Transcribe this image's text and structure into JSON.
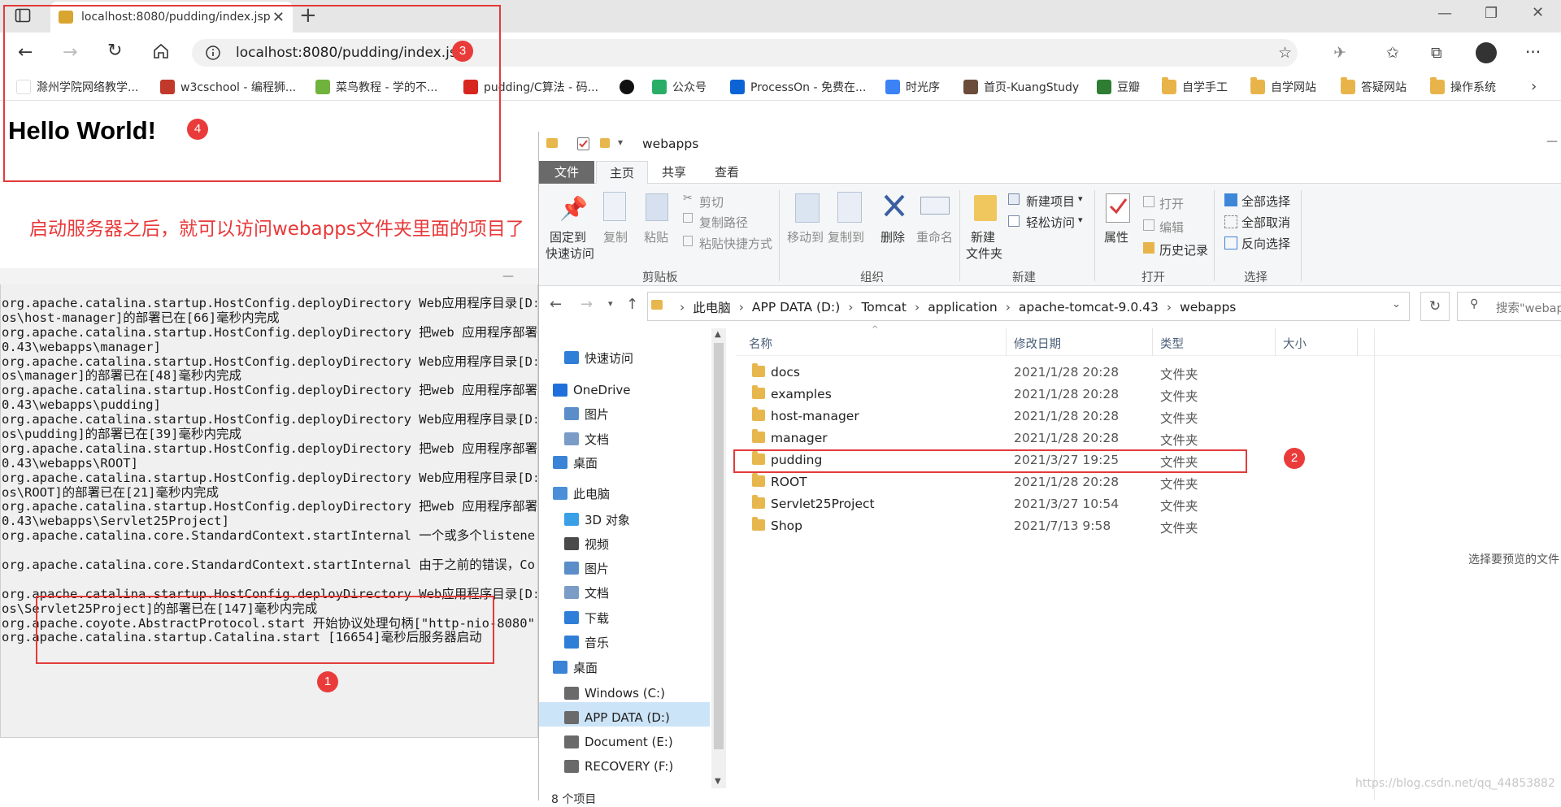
{
  "browser": {
    "tab_title": "localhost:8080/pudding/index.jsp",
    "url": "localhost:8080/pudding/index.jsp",
    "favorites": [
      {
        "label": "滁州学院网络教学...",
        "color": "#ffffff"
      },
      {
        "label": "w3cschool - 编程狮...",
        "color": "#c0392b"
      },
      {
        "label": "菜鸟教程 - 学的不...",
        "color": "#6fb33d"
      },
      {
        "label": "pudding/C算法 - 码...",
        "color": "#d7261e"
      },
      {
        "label": "",
        "color": "#111111"
      },
      {
        "label": "公众号",
        "color": "#2aae67"
      },
      {
        "label": "ProcessOn - 免费在...",
        "color": "#0b63d6"
      },
      {
        "label": "时光序",
        "color": "#3b82f6"
      },
      {
        "label": "首页-KuangStudy",
        "color": "#6b4c3b"
      },
      {
        "label": "豆瓣",
        "color": "#2e7d32"
      },
      {
        "label": "自学手工",
        "color": "#e8b44a"
      },
      {
        "label": "自学网站",
        "color": "#e8b44a"
      },
      {
        "label": "答疑网站",
        "color": "#e8b44a"
      },
      {
        "label": "操作系统",
        "color": "#e8b44a"
      }
    ]
  },
  "page": {
    "hello": "Hello World!"
  },
  "annotations": {
    "note": "启动服务器之后，就可以访问webapps文件夹里面的项目了",
    "badges": [
      "1",
      "2",
      "3",
      "4"
    ]
  },
  "console": {
    "minimize": "—",
    "lines": [
      "org.apache.catalina.startup.HostConfig.deployDirectory Web应用程序目录[D:",
      "os\\host-manager]的部署已在[66]毫秒内完成",
      "org.apache.catalina.startup.HostConfig.deployDirectory 把web 应用程序部署",
      "0.43\\webapps\\manager]",
      "org.apache.catalina.startup.HostConfig.deployDirectory Web应用程序目录[D:",
      "os\\manager]的部署已在[48]毫秒内完成",
      "org.apache.catalina.startup.HostConfig.deployDirectory 把web 应用程序部署",
      "0.43\\webapps\\pudding]",
      "org.apache.catalina.startup.HostConfig.deployDirectory Web应用程序目录[D:",
      "os\\pudding]的部署已在[39]毫秒内完成",
      "org.apache.catalina.startup.HostConfig.deployDirectory 把web 应用程序部署",
      "0.43\\webapps\\ROOT]",
      "org.apache.catalina.startup.HostConfig.deployDirectory Web应用程序目录[D:",
      "os\\ROOT]的部署已在[21]毫秒内完成",
      "org.apache.catalina.startup.HostConfig.deployDirectory 把web 应用程序部署",
      "0.43\\webapps\\Servlet25Project]",
      "org.apache.catalina.core.StandardContext.startInternal 一个或多个listener",
      "",
      "org.apache.catalina.core.StandardContext.startInternal 由于之前的错误，Co",
      "",
      "org.apache.catalina.startup.HostConfig.deployDirectory Web应用程序目录[D:",
      "os\\Servlet25Project]的部署已在[147]毫秒内完成",
      "org.apache.coyote.AbstractProtocol.start 开始协议处理句柄[\"http-nio-8080\"",
      "org.apache.catalina.startup.Catalina.start [16654]毫秒后服务器启动"
    ]
  },
  "explorer": {
    "title": "webapps",
    "ribbon_tabs": [
      "文件",
      "主页",
      "共享",
      "查看"
    ],
    "clipboard": {
      "pin": "固定到",
      "pin2": "快速访问",
      "copy": "复制",
      "paste": "粘贴",
      "cut": "剪切",
      "copy_path": "复制路径",
      "paste_shortcut": "粘贴快捷方式",
      "group": "剪贴板"
    },
    "organize": {
      "move": "移动到",
      "copy_to": "复制到",
      "delete": "删除",
      "rename": "重命名",
      "group": "组织"
    },
    "new": {
      "new_folder": "新建",
      "new_folder2": "文件夹",
      "new_item": "新建项目",
      "easy_access": "轻松访问",
      "group": "新建"
    },
    "open": {
      "properties": "属性",
      "open": "打开",
      "edit": "编辑",
      "history": "历史记录",
      "group": "打开"
    },
    "select": {
      "select_all": "全部选择",
      "select_none": "全部取消",
      "invert": "反向选择",
      "group": "选择"
    },
    "breadcrumb": [
      "此电脑",
      "APP DATA (D:)",
      "Tomcat",
      "application",
      "apache-tomcat-9.0.43",
      "webapps"
    ],
    "search_placeholder": "搜索\"webapps\"",
    "nav": [
      {
        "label": "快速访问",
        "icon": "star-icon",
        "color": "#2f7fd8",
        "indent": 1
      },
      {
        "label": "OneDrive",
        "icon": "cloud-icon",
        "color": "#1e6fd9",
        "indent": 0
      },
      {
        "label": "图片",
        "icon": "pictures-icon",
        "color": "#5b8ec9",
        "indent": 1
      },
      {
        "label": "文档",
        "icon": "documents-icon",
        "color": "#7a9cc6",
        "indent": 1
      },
      {
        "label": "桌面",
        "icon": "desktop-icon",
        "color": "#3a83d6",
        "indent": 0
      },
      {
        "label": "此电脑",
        "icon": "computer-icon",
        "color": "#4a8fd8",
        "indent": 0
      },
      {
        "label": "3D 对象",
        "icon": "3d-objects-icon",
        "color": "#39a0e6",
        "indent": 1
      },
      {
        "label": "视频",
        "icon": "videos-icon",
        "color": "#4a4a4a",
        "indent": 1
      },
      {
        "label": "图片",
        "icon": "pictures-icon",
        "color": "#5b8ec9",
        "indent": 1
      },
      {
        "label": "文档",
        "icon": "documents-icon",
        "color": "#7a9cc6",
        "indent": 1
      },
      {
        "label": "下载",
        "icon": "downloads-icon",
        "color": "#2f7fd8",
        "indent": 1
      },
      {
        "label": "音乐",
        "icon": "music-icon",
        "color": "#2f7fd8",
        "indent": 1
      },
      {
        "label": "桌面",
        "icon": "desktop-icon",
        "color": "#3a83d6",
        "indent": 0
      },
      {
        "label": "Windows (C:)",
        "icon": "drive-c-icon",
        "color": "#6a6a6a",
        "indent": 1
      },
      {
        "label": "APP DATA (D:)",
        "icon": "drive-d-icon",
        "color": "#6a6a6a",
        "indent": 1
      },
      {
        "label": "Document (E:)",
        "icon": "drive-e-icon",
        "color": "#6a6a6a",
        "indent": 1
      },
      {
        "label": "RECOVERY (F:)",
        "icon": "drive-f-icon",
        "color": "#6a6a6a",
        "indent": 1
      }
    ],
    "columns": [
      "名称",
      "修改日期",
      "类型",
      "大小"
    ],
    "files": [
      {
        "name": "docs",
        "date": "2021/1/28 20:28",
        "type": "文件夹"
      },
      {
        "name": "examples",
        "date": "2021/1/28 20:28",
        "type": "文件夹"
      },
      {
        "name": "host-manager",
        "date": "2021/1/28 20:28",
        "type": "文件夹"
      },
      {
        "name": "manager",
        "date": "2021/1/28 20:28",
        "type": "文件夹"
      },
      {
        "name": "pudding",
        "date": "2021/3/27 19:25",
        "type": "文件夹"
      },
      {
        "name": "ROOT",
        "date": "2021/1/28 20:28",
        "type": "文件夹"
      },
      {
        "name": "Servlet25Project",
        "date": "2021/3/27 10:54",
        "type": "文件夹"
      },
      {
        "name": "Shop",
        "date": "2021/7/13 9:58",
        "type": "文件夹"
      }
    ],
    "preview_note": "选择要预览的文件",
    "status": "8 个项目",
    "watermark": "https://blog.csdn.net/qq_44853882"
  }
}
